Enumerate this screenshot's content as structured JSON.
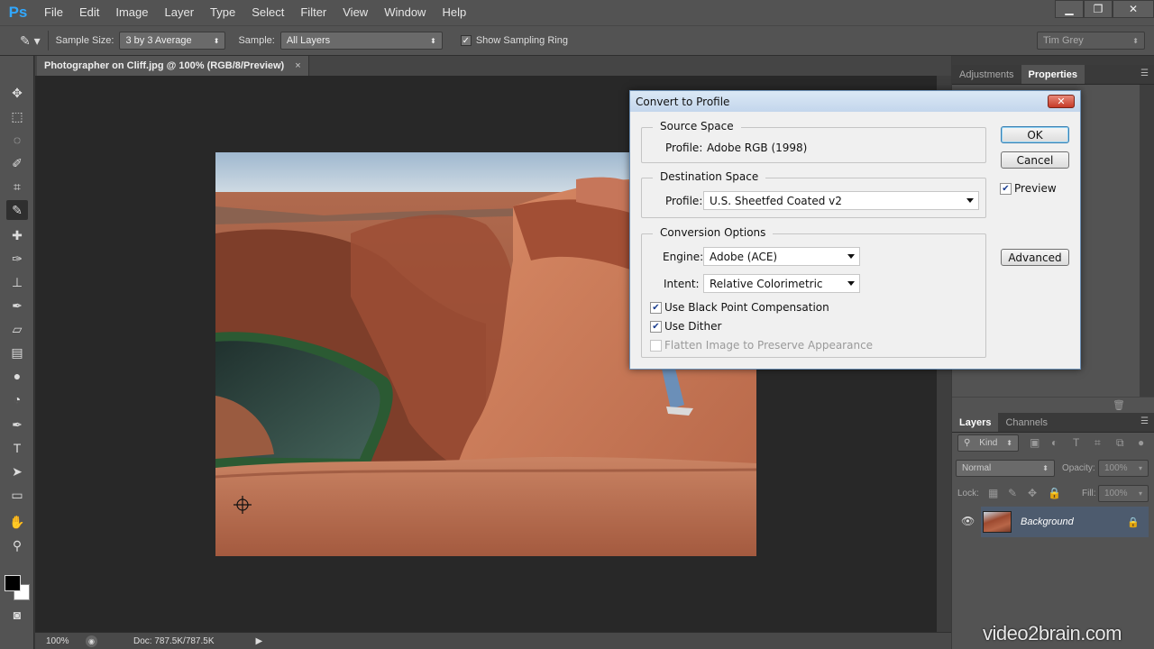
{
  "menubar": {
    "logo": "Ps",
    "items": [
      "File",
      "Edit",
      "Image",
      "Layer",
      "Type",
      "Select",
      "Filter",
      "View",
      "Window",
      "Help"
    ],
    "minimize": "▁",
    "restore": "❐",
    "close": "✕"
  },
  "options": {
    "sample_size_label": "Sample Size:",
    "sample_size_value": "3 by 3 Average",
    "sample_label": "Sample:",
    "sample_value": "All Layers",
    "show_ring_label": "Show Sampling Ring",
    "workspace": "Tim Grey"
  },
  "document": {
    "tab_title": "Photographer on Cliff.jpg @ 100% (RGB/8/Preview)",
    "tab_close": "×"
  },
  "status": {
    "zoom": "100%",
    "doc_size": "Doc: 787.5K/787.5K"
  },
  "panels": {
    "top_tabs": [
      "Adjustments",
      "Properties"
    ],
    "layers_tabs": [
      "Layers",
      "Channels"
    ],
    "kind_filter": "Kind",
    "blend_mode": "Normal",
    "opacity_label": "Opacity:",
    "opacity_value": "100%",
    "lock_label": "Lock:",
    "fill_label": "Fill:",
    "fill_value": "100%",
    "layer_name": "Background"
  },
  "dialog": {
    "title": "Convert to Profile",
    "close": "✕",
    "source_space": {
      "label": "Source Space",
      "profile_label": "Profile:",
      "profile_value": "Adobe RGB (1998)"
    },
    "destination_space": {
      "label": "Destination Space",
      "profile_label": "Profile:",
      "profile_value": "U.S. Sheetfed Coated v2"
    },
    "conversion": {
      "label": "Conversion Options",
      "engine_label": "Engine:",
      "engine_value": "Adobe (ACE)",
      "intent_label": "Intent:",
      "intent_value": "Relative Colorimetric",
      "black_point": "Use Black Point Compensation",
      "dither": "Use Dither",
      "flatten": "Flatten Image to Preserve Appearance"
    },
    "buttons": {
      "ok": "OK",
      "cancel": "Cancel",
      "preview": "Preview",
      "advanced": "Advanced"
    }
  },
  "watermark": "video2brain.com"
}
